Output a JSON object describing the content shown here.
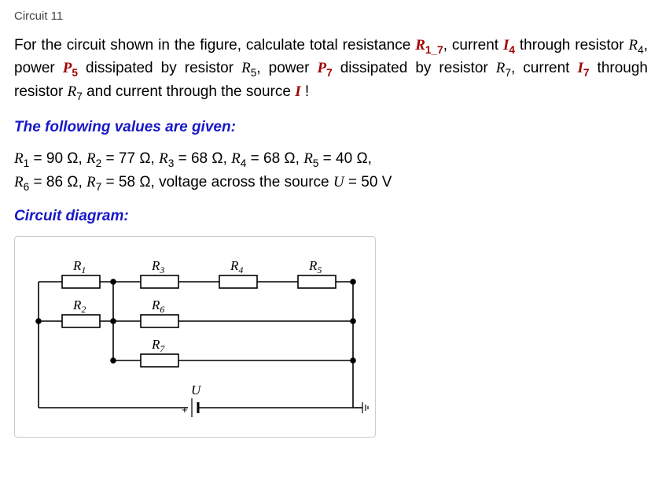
{
  "title": "Circuit 11",
  "problem": {
    "t1": "For the circuit shown in the figure, calculate total resistance ",
    "R17": "R",
    "R17sub": "1_7",
    "t2": ", current ",
    "I4": "I",
    "I4sub": "4",
    "t3": " through resistor ",
    "R4": "R",
    "R4sub": "4",
    "t4": ", power ",
    "P5": "P",
    "P5sub": "5",
    "t5": " dissipated by resistor ",
    "R5": "R",
    "R5sub": "5",
    "t6": ", power ",
    "P7": "P",
    "P7sub": "7",
    "t7": " dissipated by resistor ",
    "R7": "R",
    "R7sub": "7",
    "t8": ", current ",
    "I7": "I",
    "I7sub": "7",
    "t9": " through resistor ",
    "R7b": "R",
    "R7bsub": "7",
    "t10": " and current through the source ",
    "I": "I",
    "t11": " !"
  },
  "given_heading": "The following values are given:",
  "values": {
    "line1_a": "R",
    "line1_a_sub": "1",
    "line1_a_eq": " = 90 Ω,  ",
    "line1_b": "R",
    "line1_b_sub": "2",
    "line1_b_eq": " = 77 Ω,  ",
    "line1_c": "R",
    "line1_c_sub": "3",
    "line1_c_eq": " = 68 Ω,  ",
    "line1_d": "R",
    "line1_d_sub": "4",
    "line1_d_eq": " = 68 Ω,  ",
    "line1_e": "R",
    "line1_e_sub": "5",
    "line1_e_eq": " = 40 Ω,",
    "line2_a": "R",
    "line2_a_sub": "6",
    "line2_a_eq": " = 86 Ω,  ",
    "line2_b": "R",
    "line2_b_sub": "7",
    "line2_b_eq": " = 58 Ω,  ",
    "line2_c": "voltage across the source ",
    "line2_d": "U",
    "line2_d_eq": " = 50 V"
  },
  "diagram_heading": "Circuit diagram:",
  "diagram": {
    "R1": "R",
    "R1s": "1",
    "R2": "R",
    "R2s": "2",
    "R3": "R",
    "R3s": "3",
    "R4": "R",
    "R4s": "4",
    "R5": "R",
    "R5s": "5",
    "R6": "R",
    "R6s": "6",
    "R7": "R",
    "R7s": "7",
    "U": "U",
    "plus": "+"
  }
}
